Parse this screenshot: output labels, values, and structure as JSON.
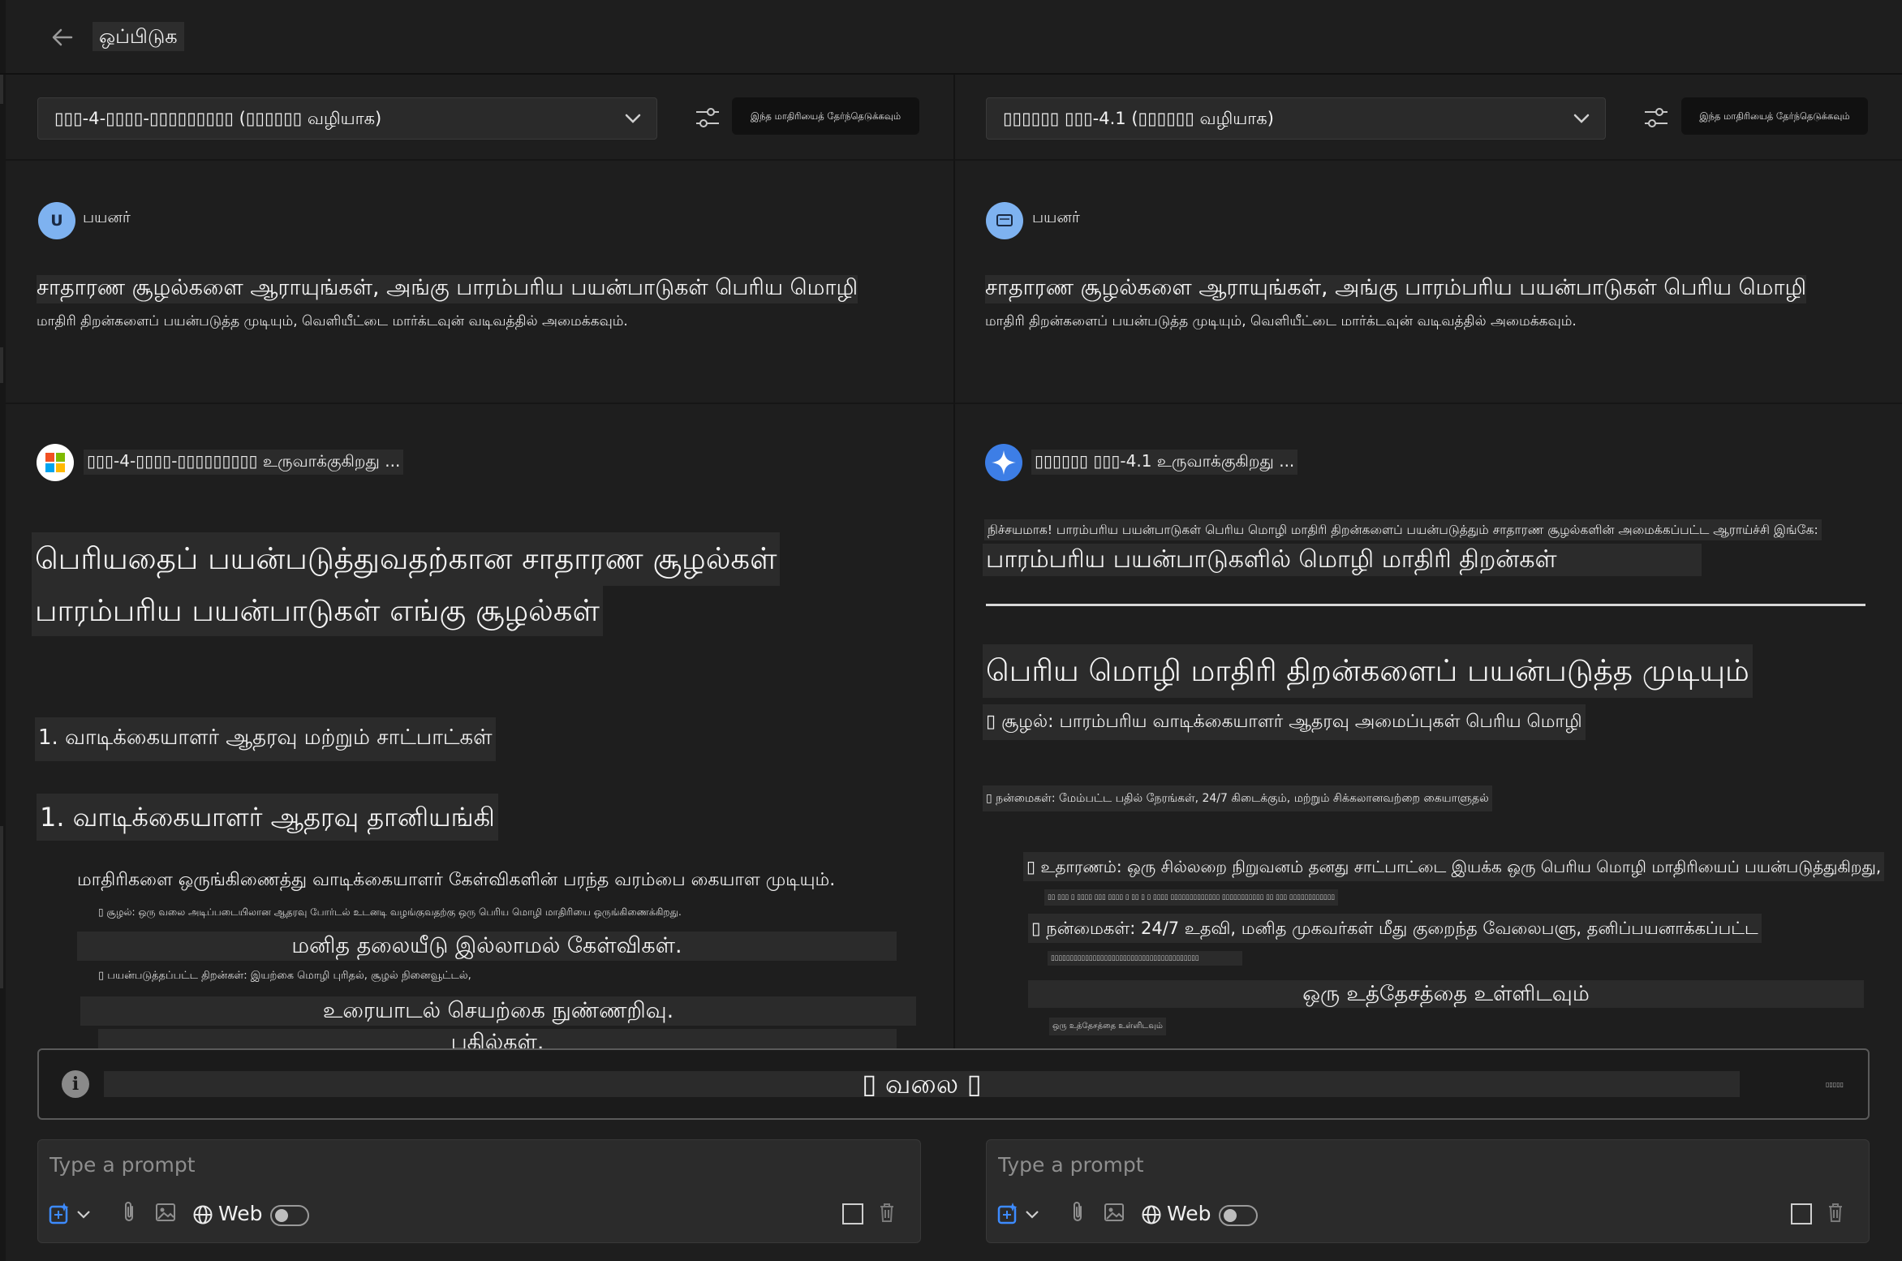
{
  "header": {
    "back_icon": "arrow-left-icon",
    "title": "ஒப்பிடுக"
  },
  "left_panel": {
    "model_select_value": "▯▯▯-4-▯▯▯▯-▯▯▯▯▯▯▯▯▯ (▯▯▯▯▯▯ வழியாக)",
    "pick_button": "இந்த மாதிரியைத் தேர்ந்தெடுக்கவும்",
    "user_avatar_letter": "U",
    "user_label": "பயனர்",
    "prompt_line1": "சாதாரண சூழல்களை ஆராயுங்கள், அங்கு பாரம்பரிய பயன்பாடுகள் பெரிய மொழி",
    "prompt_line2": "மாதிரி திறன்களைப் பயன்படுத்த முடியும், வெளியீட்டை மார்க்டவுன் வடிவத்தில் அமைக்கவும்.",
    "gen_label": "▯▯▯-4-▯▯▯▯-▯▯▯▯▯▯▯▯▯ உருவாக்குகிறது ...",
    "response": {
      "h1_line1": "பெரியதைப் பயன்படுத்துவதற்கான சாதாரண சூழல்கள்",
      "h1_line2": "பாரம்பரிய பயன்பாடுகள் எங்கு சூழல்கள்",
      "list1": "1. வாடிக்கையாளர் ஆதரவு மற்றும் சாட்பாட்கள்",
      "h3": "1. வாடிக்கையாளர் ஆதரவு தானியங்கி",
      "para1": "மாதிரிகளை ஒருங்கிணைத்து வாடிக்கையாளர் கேள்விகளின் பரந்த வரம்பை கையாள முடியும்.",
      "small1": "▯ சூழல்: ஒரு வலை அடிப்படையிலான ஆதரவு போர்டல் உடனடி வழங்குவதற்கு ஒரு பெரிய மொழி மாதிரியை ஒருங்கிணைக்கிறது.",
      "center1": "மனித தலையீடு இல்லாமல் கேள்விகள்.",
      "small2": "▯ பயன்படுத்தப்பட்ட திறன்கள்: இயற்கை மொழி புரிதல், சூழல் நினைவூட்டல்,",
      "center2": "உரையாடல் செயற்கை நுண்ணறிவு.",
      "center3": "பதில்கள்.",
      "glyph": "▯"
    }
  },
  "right_panel": {
    "model_select_value": "▯▯▯▯▯▯ ▯▯▯-4.1 (▯▯▯▯▯▯ வழியாக)",
    "pick_button": "இந்த மாதிரியைத் தேர்ந்தெடுக்கவும்",
    "user_label": "பயனர்",
    "prompt_line1": "சாதாரண சூழல்களை ஆராயுங்கள், அங்கு பாரம்பரிய பயன்பாடுகள் பெரிய மொழி",
    "prompt_line2": "மாதிரி திறன்களைப் பயன்படுத்த முடியும், வெளியீட்டை மார்க்டவுன் வடிவத்தில் அமைக்கவும்.",
    "gen_label": "▯▯▯▯▯▯ ▯▯▯-4.1 உருவாக்குகிறது ...",
    "response": {
      "intro": "நிச்சயமாக! பாரம்பரிய பயன்பாடுகள் பெரிய மொழி மாதிரி திறன்களைப் பயன்படுத்தும் சாதாரண சூழல்களின் அமைக்கப்பட்ட ஆராய்ச்சி இங்கே:",
      "h2": "பாரம்பரிய பயன்பாடுகளில் மொழி மாதிரி திறன்கள்",
      "h1": "பெரிய மொழி மாதிரி திறன்களைப் பயன்படுத்த முடியும்",
      "env": "▯ சூழல்: பாரம்பரிய வாடிக்கையாளர் ஆதரவு அமைப்புகள் பெரிய மொழி",
      "benefits1": "▯ நன்மைகள்: மேம்பட்ட பதில் நேரங்கள், 24/7 கிடைக்கும், மற்றும் சிக்கலானவற்றை கையாளுதல்",
      "example": "▯ உதாரணம்: ஒரு சில்லறை நிறுவனம் தனது சாட்பாட்டை இயக்க ஒரு பெரிய மொழி மாதிரியைப் பயன்படுத்துகிறது,",
      "tiny1": "▯▯ ▯▯▯ ▯ ▯▯▯▯ ▯▯▯ ▯▯▯▯ ▯ ▯▯ ▯ ▯ ▯▯▯▯ ▯▯▯▯▯▯▯▯▯▯▯▯▯ ▯▯▯▯▯▯▯▯▯▯▯ ▯▯ ▯▯▯ ▯▯▯▯▯▯▯▯▯▯▯▯",
      "benefits2": "▯ நன்மைகள்: 24/7 உதவி, மனித முகவர்கள் மீது குறைந்த வேலைபளு, தனிப்பயனாக்கப்பட்ட",
      "tiny2": "▯▯▯▯▯▯▯▯▯▯▯▯▯▯▯▯▯▯▯▯▯▯▯▯▯▯▯▯▯▯▯▯▯▯▯▯▯▯▯",
      "center1": "ஒரு உத்தேசத்தை உள்ளிடவும்",
      "tiny3": "ஒரு உத்தேசத்தை உள்ளிடவும்"
    }
  },
  "info_bar": {
    "icon": "info-icon",
    "text": "▯ வலை ▯",
    "small": "▯▯▯▯▯"
  },
  "prompt_bars": [
    {
      "placeholder": "Type a prompt",
      "web_label": "Web",
      "web_enabled": false
    },
    {
      "placeholder": "Type a prompt",
      "web_label": "Web",
      "web_enabled": false
    }
  ]
}
